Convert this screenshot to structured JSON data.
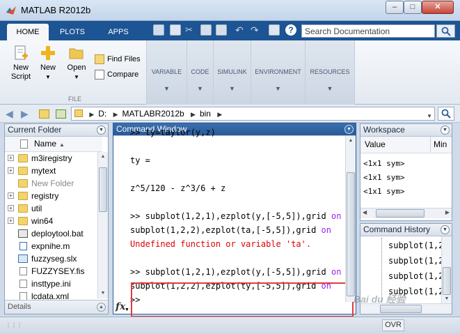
{
  "window": {
    "title": "MATLAB R2012b"
  },
  "tabs": [
    {
      "label": "HOME"
    },
    {
      "label": "PLOTS"
    },
    {
      "label": "APPS"
    }
  ],
  "search": {
    "placeholder": "Search Documentation"
  },
  "ribbon": {
    "new_script": "New\nScript",
    "new_script_l1": "New",
    "new_script_l2": "Script",
    "new": "New",
    "open": "Open",
    "find_files": "Find Files",
    "compare": "Compare",
    "file_section": "FILE",
    "collapsed": [
      "VARIABLE",
      "CODE",
      "SIMULINK",
      "ENVIRONMENT",
      "RESOURCES"
    ]
  },
  "address": {
    "crumbs": [
      "D:",
      "MATLABR2012b",
      "bin"
    ]
  },
  "current_folder": {
    "title": "Current Folder",
    "col_name": "Name",
    "items": [
      {
        "name": "m3iregistry",
        "type": "folder",
        "expand": true,
        "grey": false
      },
      {
        "name": "mytext",
        "type": "folder",
        "expand": true,
        "grey": false
      },
      {
        "name": "New Folder",
        "type": "folder",
        "expand": false,
        "grey": true
      },
      {
        "name": "registry",
        "type": "folder",
        "expand": true,
        "grey": false
      },
      {
        "name": "util",
        "type": "folder",
        "expand": true,
        "grey": false
      },
      {
        "name": "win64",
        "type": "folder",
        "expand": true,
        "grey": false
      },
      {
        "name": "deploytool.bat",
        "type": "bat",
        "expand": false,
        "grey": false
      },
      {
        "name": "expnihe.m",
        "type": "mfile",
        "expand": false,
        "grey": false
      },
      {
        "name": "fuzzyseg.slx",
        "type": "slx",
        "expand": false,
        "grey": false
      },
      {
        "name": "FUZZYSEY.fis",
        "type": "file",
        "expand": false,
        "grey": false
      },
      {
        "name": "insttype.ini",
        "type": "file",
        "expand": false,
        "grey": false
      },
      {
        "name": "lcdata.xml",
        "type": "file",
        "expand": false,
        "grey": false
      }
    ],
    "details": "Details"
  },
  "command_window": {
    "title": "Command Window",
    "lines": [
      {
        "segments": [
          {
            "t": ">> ty=taylor(y,z)",
            "c": ""
          }
        ]
      },
      {
        "segments": [
          {
            "t": "",
            "c": ""
          }
        ]
      },
      {
        "segments": [
          {
            "t": "ty =",
            "c": ""
          }
        ]
      },
      {
        "segments": [
          {
            "t": "",
            "c": ""
          }
        ]
      },
      {
        "segments": [
          {
            "t": "z^5/120 - z^3/6 + z",
            "c": ""
          }
        ]
      },
      {
        "segments": [
          {
            "t": "",
            "c": ""
          }
        ]
      },
      {
        "segments": [
          {
            "t": ">> subplot(1,2,1),ezplot(y,[-5,5]),grid ",
            "c": ""
          },
          {
            "t": "on",
            "c": "kw"
          }
        ]
      },
      {
        "segments": [
          {
            "t": "subplot(1,2,2),ezplot(ta,[-5,5]),grid ",
            "c": ""
          },
          {
            "t": "on",
            "c": "kw"
          }
        ]
      },
      {
        "segments": [
          {
            "t": "Undefined function or variable 'ta'.",
            "c": "err"
          }
        ]
      },
      {
        "segments": [
          {
            "t": "",
            "c": ""
          }
        ]
      },
      {
        "segments": [
          {
            "t": ">> subplot(1,2,1),ezplot(y,[-5,5]),grid ",
            "c": ""
          },
          {
            "t": "on",
            "c": "kw"
          }
        ]
      },
      {
        "segments": [
          {
            "t": "subplot(1,2,2),ezplot(ty,[-5,5]),grid ",
            "c": ""
          },
          {
            "t": "on",
            "c": "kw"
          }
        ]
      },
      {
        "segments": [
          {
            "t": ">>",
            "c": ""
          }
        ]
      }
    ],
    "fx": "fx"
  },
  "workspace": {
    "title": "Workspace",
    "col_value": "Value",
    "col_min": "Min",
    "rows": [
      "<1x1 sym>",
      "<1x1 sym>",
      "<1x1 sym>"
    ]
  },
  "command_history": {
    "title": "Command History",
    "lines": [
      "subplot(1,2",
      "subplot(1,2",
      "subplot(1,2",
      "subplot(1,2"
    ]
  },
  "status": {
    "ovr": "OVR",
    "watermark": "Bai du 经验"
  }
}
